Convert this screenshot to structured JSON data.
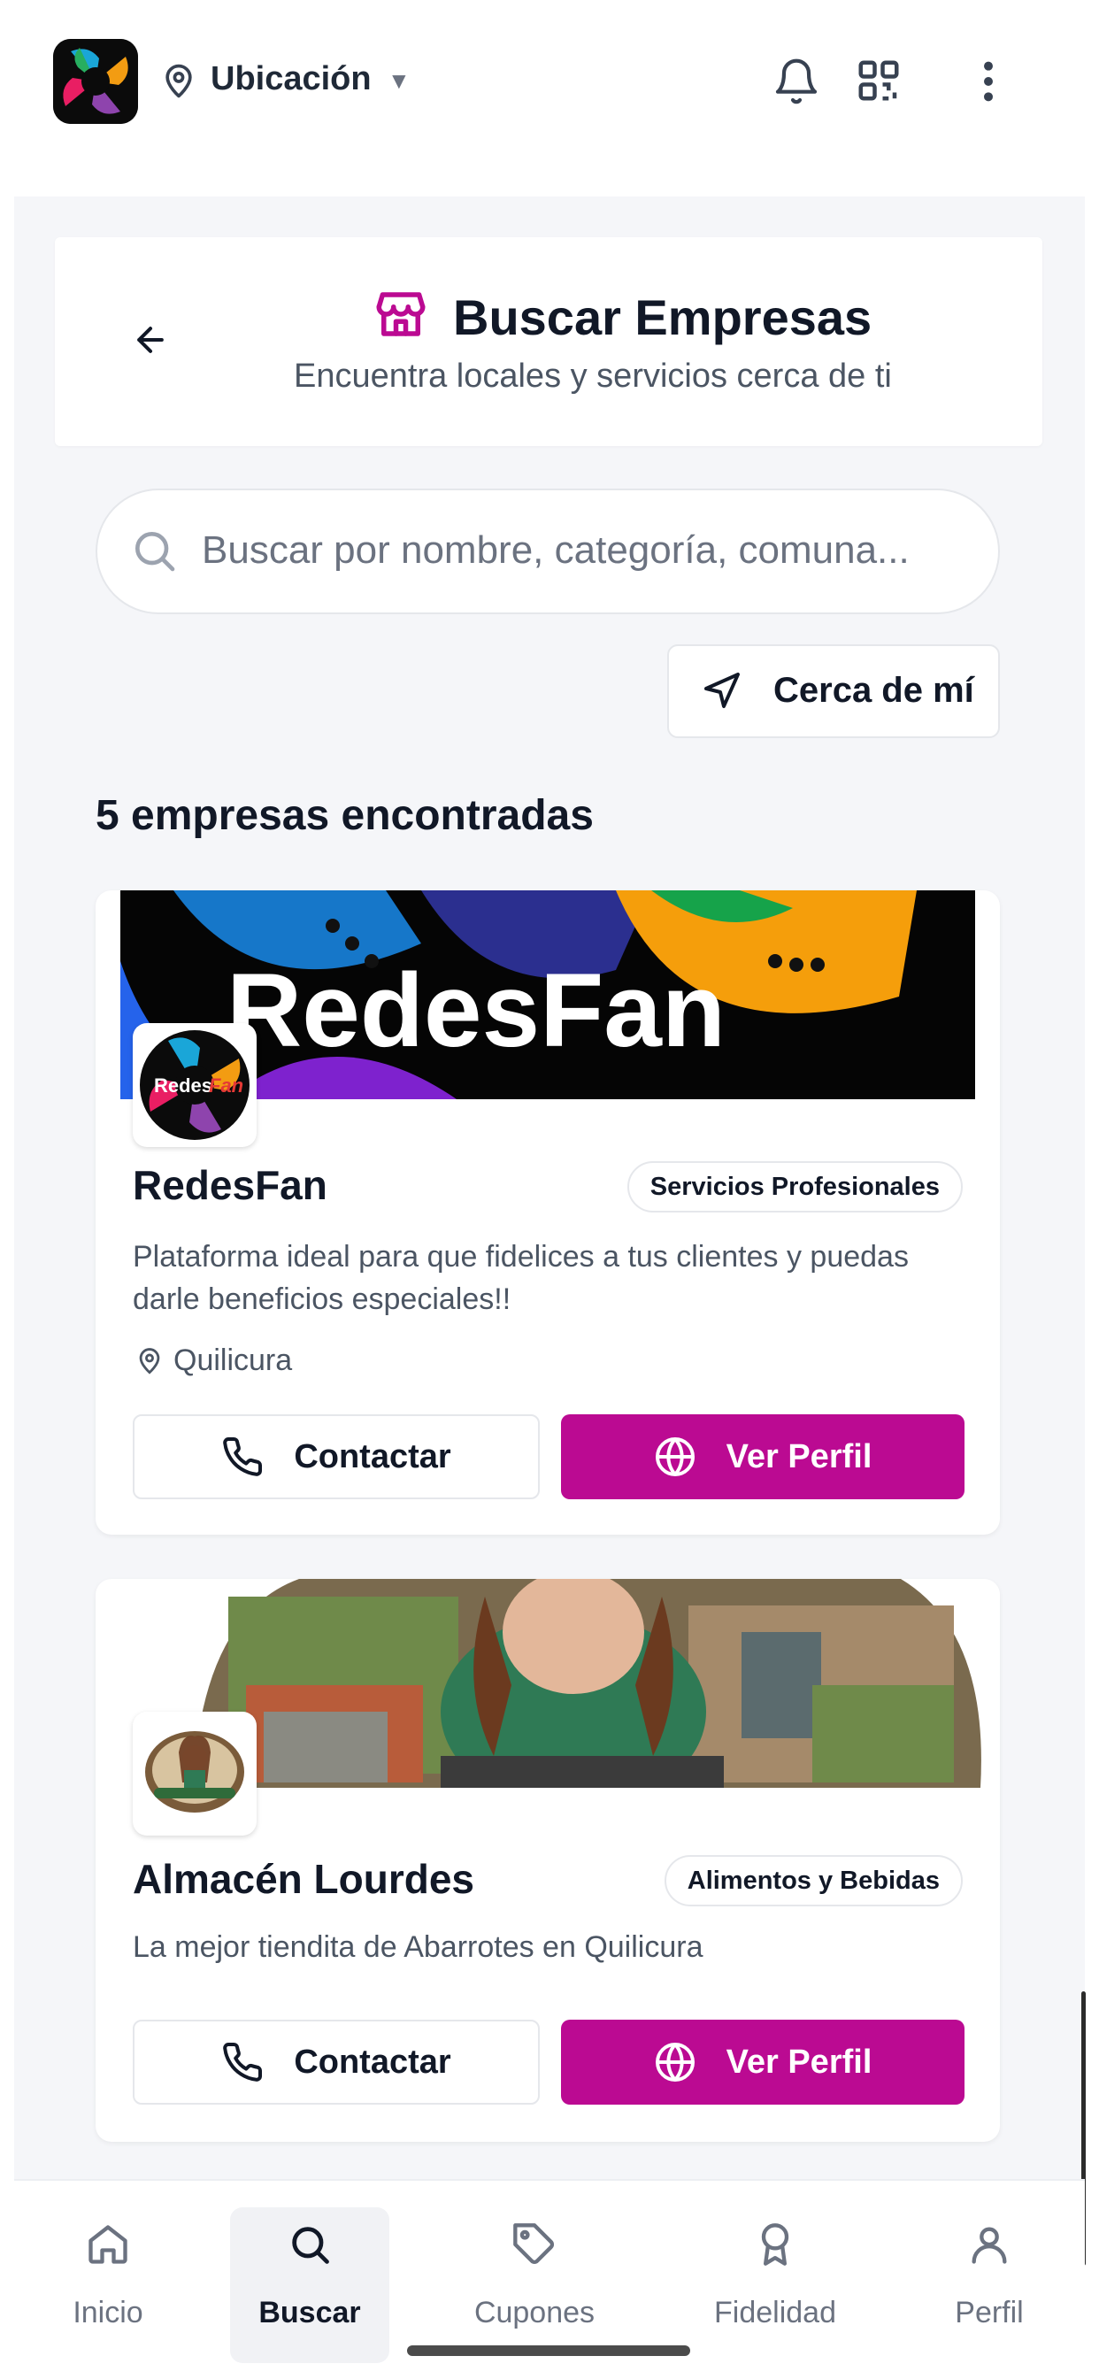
{
  "topbar": {
    "location_label": "Ubicación",
    "caret": "▼",
    "icons": [
      "map-pin-icon",
      "bell-icon",
      "qr-code-icon",
      "more-vertical-icon"
    ]
  },
  "header": {
    "title": "Buscar Empresas",
    "subtitle": "Encuentra locales y servicios cerca de ti",
    "icons": [
      "arrow-left-icon",
      "store-icon"
    ]
  },
  "search": {
    "placeholder": "Buscar por nombre, categoría, comuna..."
  },
  "near_button": {
    "label": "Cerca de mí"
  },
  "results": {
    "count_label": "5 empresas encontradas"
  },
  "businesses": [
    {
      "name": "RedesFan",
      "category": "Servicios Profesionales",
      "description": "Plataforma ideal para que fidelices a tus clientes y puedas darle beneficios especiales!!",
      "location": "Quilicura",
      "banner_text": "RedesFan",
      "logo_text": "Redes",
      "logo_text_accent": "Fan",
      "contact_label": "Contactar",
      "profile_label": "Ver Perfil"
    },
    {
      "name": "Almacén Lourdes",
      "category": "Alimentos y Bebidas",
      "description": "La mejor tiendita de Abarrotes en Quilicura",
      "contact_label": "Contactar",
      "profile_label": "Ver Perfil"
    }
  ],
  "bottom_nav": {
    "items": [
      {
        "label": "Inicio",
        "icon": "home-icon"
      },
      {
        "label": "Buscar",
        "icon": "search-icon",
        "active": true
      },
      {
        "label": "Cupones",
        "icon": "tag-icon"
      },
      {
        "label": "Fidelidad",
        "icon": "award-icon"
      },
      {
        "label": "Perfil",
        "icon": "user-icon"
      }
    ]
  },
  "colors": {
    "accent": "#bb0a92",
    "background": "#f5f6f9",
    "text": "#111827",
    "muted": "#4b5563"
  }
}
